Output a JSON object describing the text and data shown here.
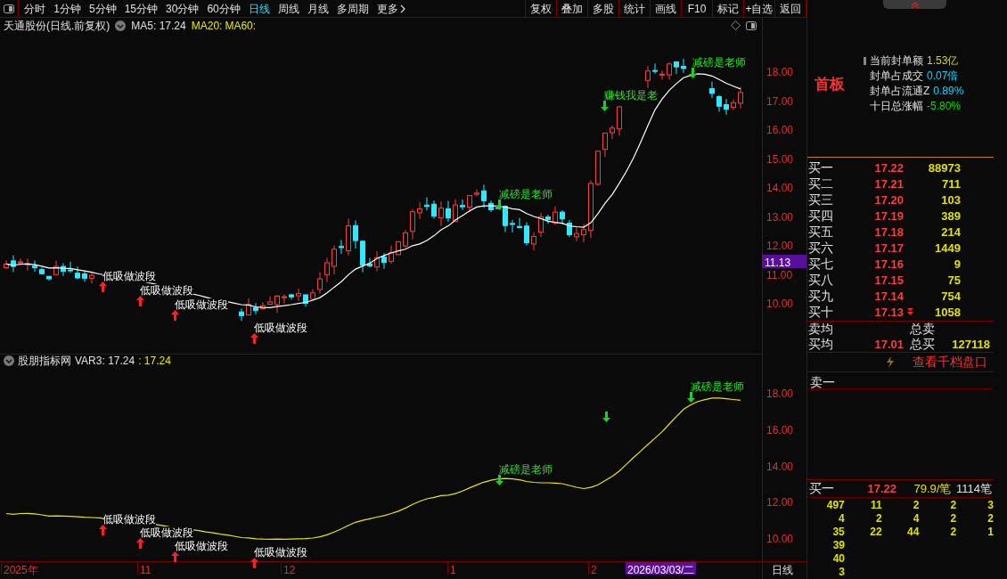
{
  "toolbar": {
    "periods": [
      {
        "label": "分时",
        "selected": false
      },
      {
        "label": "1分钟",
        "selected": false
      },
      {
        "label": "5分钟",
        "selected": false
      },
      {
        "label": "15分钟",
        "selected": false
      },
      {
        "label": "30分钟",
        "selected": false
      },
      {
        "label": "60分钟",
        "selected": false
      },
      {
        "label": "日线",
        "selected": true
      },
      {
        "label": "周线",
        "selected": false
      },
      {
        "label": "月线",
        "selected": false
      },
      {
        "label": "多周期",
        "selected": false
      },
      {
        "label": "更多",
        "selected": false
      }
    ],
    "buttons": [
      "复权",
      "叠加",
      "多股",
      "统计",
      "画线",
      "F10",
      "标记",
      "+自选",
      "返回"
    ]
  },
  "main_chart": {
    "title": "天通股份(日线.前复权)",
    "ma5": "MA5: 17.24",
    "ma20": "MA20:",
    "ma60": "MA60:",
    "price_axis": [
      "18.00",
      "17.00",
      "16.00",
      "15.00",
      "14.00",
      "13.00",
      "12.00",
      "11.00",
      "10.00"
    ],
    "cursor_price": "11.13",
    "annotations": [
      {
        "text": "低吸做波段",
        "kind": "buy"
      },
      {
        "text": "低吸做波段",
        "kind": "buy"
      },
      {
        "text": "低吸做波段",
        "kind": "buy"
      },
      {
        "text": "低吸做波段",
        "kind": "buy"
      },
      {
        "text": "减磅是老师",
        "kind": "sell"
      },
      {
        "text": "赚钱我是老",
        "kind": "sell"
      },
      {
        "text": "减磅是老师",
        "kind": "sell"
      }
    ]
  },
  "indicator_chart": {
    "title": "股朋指标网",
    "var3": "VAR3: 17.24",
    "value": ": 17.24",
    "axis": [
      "18.00",
      "16.00",
      "14.00",
      "12.00",
      "10.00"
    ],
    "annotations": [
      {
        "text": "低吸做波段",
        "kind": "buy"
      },
      {
        "text": "低吸做波段",
        "kind": "buy"
      },
      {
        "text": "低吸做波段",
        "kind": "buy"
      },
      {
        "text": "低吸做波段",
        "kind": "buy"
      },
      {
        "text": "减磅是老师",
        "kind": "sell"
      },
      {
        "kind": "sell"
      },
      {
        "text": "减磅是老师",
        "kind": "sell"
      }
    ]
  },
  "time_axis": {
    "labels": [
      "2025年",
      "11",
      "12",
      "1",
      "2"
    ],
    "cursor_date": "2026/03/03/二",
    "period": "日线"
  },
  "side_panel": {
    "badge": "首板",
    "stats": [
      {
        "label": "当前封单额",
        "value": "1.53亿",
        "color": "#d8d800"
      },
      {
        "label": "封单占成交",
        "value": "0.07倍",
        "color": "#00d8ff"
      },
      {
        "label": "封单占流通Z",
        "value": "0.89%",
        "color": "#00d8ff"
      },
      {
        "label": "十日总涨幅",
        "value": "-5.80%",
        "color": "#00e000"
      }
    ],
    "bids": [
      {
        "label": "买一",
        "price": "17.22",
        "volume": "88973",
        "flag": false
      },
      {
        "label": "买二",
        "price": "17.21",
        "volume": "711",
        "flag": false
      },
      {
        "label": "买三",
        "price": "17.20",
        "volume": "103",
        "flag": false
      },
      {
        "label": "买四",
        "price": "17.19",
        "volume": "389",
        "flag": false
      },
      {
        "label": "买五",
        "price": "17.18",
        "volume": "214",
        "flag": false
      },
      {
        "label": "买六",
        "price": "17.17",
        "volume": "1449",
        "flag": false
      },
      {
        "label": "买七",
        "price": "17.16",
        "volume": "9",
        "flag": false
      },
      {
        "label": "买八",
        "price": "17.15",
        "volume": "75",
        "flag": false
      },
      {
        "label": "买九",
        "price": "17.14",
        "volume": "754",
        "flag": false
      },
      {
        "label": "买十",
        "price": "17.13",
        "volume": "1058",
        "flag": true
      }
    ],
    "sell_avg": {
      "label": "卖均",
      "total_label": "总卖"
    },
    "buy_avg": {
      "label": "买均",
      "price": "17.01",
      "total_label": "总买",
      "total": "127118"
    },
    "depth_link": "查看千档盘口",
    "ask_label": "卖一",
    "queue_head": {
      "label": "买一",
      "price": "17.22",
      "avg": "79.9/笔",
      "count": "1114笔"
    },
    "queue": [
      [
        "497",
        "11",
        "2",
        "2",
        "3"
      ],
      [
        "4",
        "2",
        "4",
        "2",
        "2"
      ],
      [
        "35",
        "22",
        "44",
        "2",
        "1"
      ],
      [
        "39"
      ],
      [
        "40"
      ],
      [
        "3"
      ]
    ]
  }
}
